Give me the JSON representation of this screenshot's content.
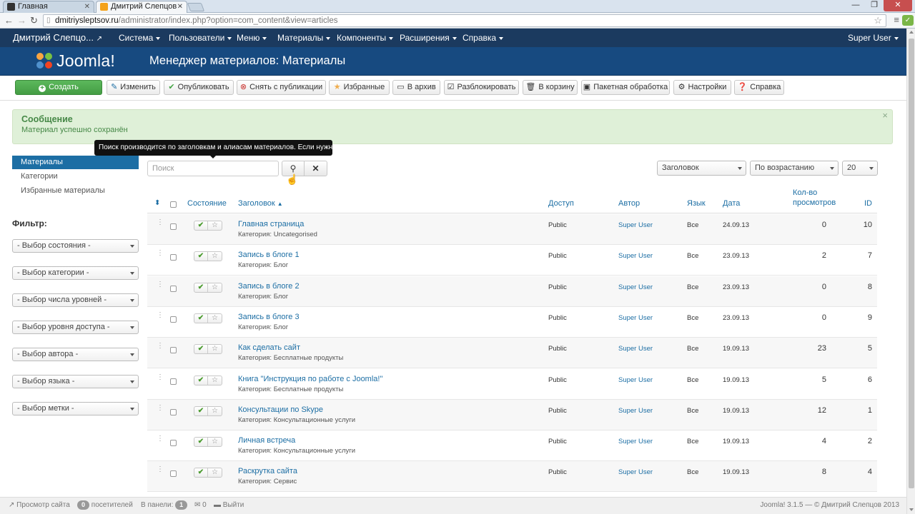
{
  "browser": {
    "tabs": [
      {
        "label": "Главная",
        "fav_color": "#333333"
      },
      {
        "label": "Дмитрий Слепцов -",
        "fav_color": "#f4a21b"
      }
    ],
    "url_host": "dmitriysleptsov.ru",
    "url_path": "/administrator/index.php?option=com_content&view=articles"
  },
  "topnav": {
    "site": "Дмитрий Слепцо...",
    "items": [
      "Система",
      "Пользователи",
      "Меню",
      "Материалы",
      "Компоненты",
      "Расширения",
      "Справка"
    ],
    "user": "Super User"
  },
  "header": {
    "logo": "Joomla!",
    "title": "Менеджер материалов: Материалы"
  },
  "toolbar": {
    "create": "Создать",
    "edit": "Изменить",
    "publish": "Опубликовать",
    "unpublish": "Снять с публикации",
    "featured": "Избранные",
    "archive": "В архив",
    "checkin": "Разблокировать",
    "trash": "В корзину",
    "batch": "Пакетная обработка",
    "options": "Настройки",
    "help": "Справка"
  },
  "message": {
    "heading": "Сообщение",
    "text": "Материал успешно сохранён"
  },
  "tooltip": "Поиск производится по заголовкам и алиасам материалов. Если нужно на",
  "sidebar": {
    "items": [
      "Материалы",
      "Категории",
      "Избранные материалы"
    ]
  },
  "filter": {
    "heading": "Фильтр:",
    "selects": [
      "- Выбор состояния -",
      "- Выбор категории -",
      "- Выбор числа уровней -",
      "- Выбор уровня доступа -",
      "- Выбор автора -",
      "- Выбор языка -",
      "- Выбор метки -"
    ]
  },
  "search": {
    "placeholder": "Поиск"
  },
  "sort": {
    "field": "Заголовок",
    "order": "По возрастанию",
    "limit": "20"
  },
  "table": {
    "headers": {
      "status": "Состояние",
      "title": "Заголовок",
      "access": "Доступ",
      "author": "Автор",
      "language": "Язык",
      "date": "Дата",
      "hits": "Кол-во просмотров",
      "id": "ID"
    },
    "rows": [
      {
        "title": "Главная страница",
        "category": "Категория: Uncategorised",
        "access": "Public",
        "author": "Super User",
        "lang": "Все",
        "date": "24.09.13",
        "hits": "0",
        "id": "10"
      },
      {
        "title": "Запись в блоге 1",
        "category": "Категория: Блог",
        "access": "Public",
        "author": "Super User",
        "lang": "Все",
        "date": "23.09.13",
        "hits": "2",
        "id": "7"
      },
      {
        "title": "Запись в блоге 2",
        "category": "Категория: Блог",
        "access": "Public",
        "author": "Super User",
        "lang": "Все",
        "date": "23.09.13",
        "hits": "0",
        "id": "8"
      },
      {
        "title": "Запись в блоге 3",
        "category": "Категория: Блог",
        "access": "Public",
        "author": "Super User",
        "lang": "Все",
        "date": "23.09.13",
        "hits": "0",
        "id": "9"
      },
      {
        "title": "Как сделать сайт",
        "category": "Категория: Бесплатные продукты",
        "access": "Public",
        "author": "Super User",
        "lang": "Все",
        "date": "19.09.13",
        "hits": "23",
        "id": "5"
      },
      {
        "title": "Книга \"Инструкция по работе с Joomla!\"",
        "category": "Категория: Бесплатные продукты",
        "access": "Public",
        "author": "Super User",
        "lang": "Все",
        "date": "19.09.13",
        "hits": "5",
        "id": "6"
      },
      {
        "title": "Консультации по Skype",
        "category": "Категория: Консультационные услуги",
        "access": "Public",
        "author": "Super User",
        "lang": "Все",
        "date": "19.09.13",
        "hits": "12",
        "id": "1"
      },
      {
        "title": "Личная встреча",
        "category": "Категория: Консультационные услуги",
        "access": "Public",
        "author": "Super User",
        "lang": "Все",
        "date": "19.09.13",
        "hits": "4",
        "id": "2"
      },
      {
        "title": "Раскрутка сайта",
        "category": "Категория: Сервис",
        "access": "Public",
        "author": "Super User",
        "lang": "Все",
        "date": "19.09.13",
        "hits": "8",
        "id": "4"
      }
    ]
  },
  "footer": {
    "view_site": "Просмотр сайта",
    "visitors_count": "0",
    "visitors_label": "посетителей",
    "admin_label": "В панели:",
    "admin_count": "1",
    "messages_count": "0",
    "logout": "Выйти",
    "copyright": "Joomla! 3.1.5 — © Дмитрий Слепцов 2013"
  }
}
